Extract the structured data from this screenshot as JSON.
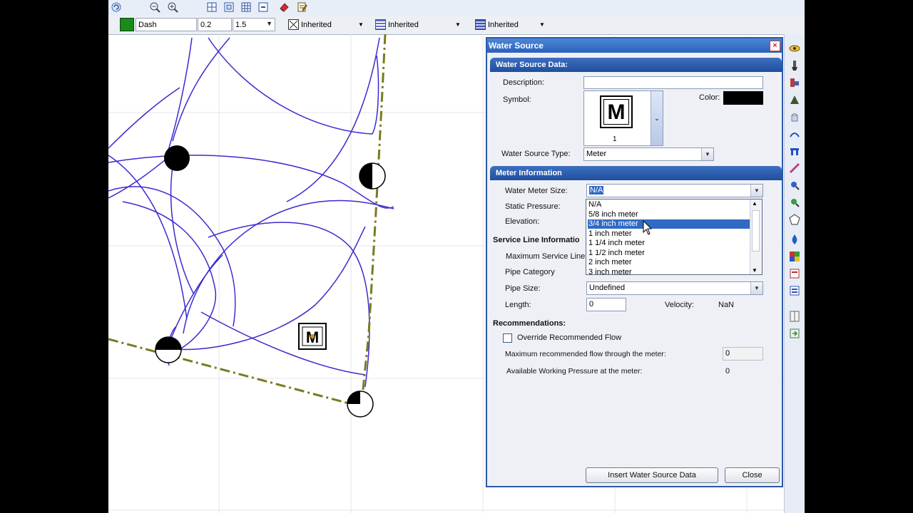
{
  "toolbar": {
    "line_style": "Dash",
    "line_width": "0.2",
    "scale": "1.5",
    "style1": "Inherited",
    "style2": "Inherited",
    "style3": "Inherited"
  },
  "canvas": {
    "meter_symbol": "M"
  },
  "dialog": {
    "title": "Water Source",
    "section1": "Water Source Data:",
    "description_label": "Description:",
    "description_value": "",
    "symbol_label": "Symbol:",
    "symbol_glyph": "M",
    "symbol_number": "1",
    "color_label": "Color:",
    "symbol_color": "#000000",
    "type_label": "Water Source Type:",
    "type_value": "Meter",
    "section2": "Meter Information",
    "meter_size_label": "Water Meter Size:",
    "meter_size_value": "N/A",
    "static_pressure_label": "Static Pressure:",
    "elevation_label": "Elevation:",
    "service_line_header": "Service Line Informatio",
    "max_service_line_label": "Maximum Service Line",
    "pipe_category_label": "Pipe Category",
    "pipe_size_label": "Pipe Size:",
    "pipe_size_value": "Undefined",
    "length_label": "Length:",
    "length_value": "0",
    "velocity_label": "Velocity:",
    "velocity_value": "NaN",
    "recommendations_label": "Recommendations:",
    "override_label": "Override Recommended Flow",
    "max_flow_label": "Maximum recommended flow through the meter:",
    "max_flow_value": "0",
    "available_pressure_label": "Available Working Pressure at the meter:",
    "available_pressure_value": "0",
    "insert_button": "Insert Water Source Data",
    "close_button": "Close",
    "meter_sizes": [
      "N/A",
      "5/8 inch meter",
      "3/4 inch meter",
      "1 inch meter",
      "1 1/4 inch meter",
      "1 1/2 inch meter",
      "2 inch meter",
      "3 inch meter"
    ],
    "selected_meter_size": "3/4 inch meter"
  },
  "colors": {
    "title_bar": "#2a62bc",
    "section_header": "#1f4f9e",
    "selection": "#316ac5",
    "arc_lines": "#3a2ad0",
    "boundary": "#7a7a20"
  }
}
